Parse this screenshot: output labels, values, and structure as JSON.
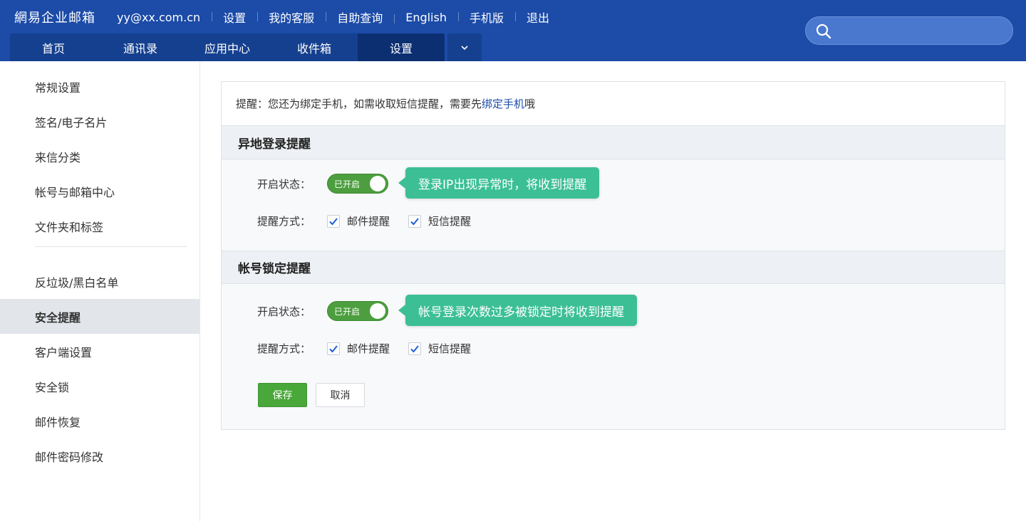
{
  "header": {
    "brand": "網易企业邮箱",
    "email": "yy@xx.com.cn",
    "links": [
      "设置",
      "我的客服",
      "自助查询",
      "English",
      "手机版",
      "退出"
    ],
    "search_placeholder": ""
  },
  "nav": {
    "tabs": [
      "首页",
      "通讯录",
      "应用中心",
      "收件箱",
      "设置"
    ],
    "active_tab": "设置",
    "more_icon": "chevron-down-icon"
  },
  "sidebar": {
    "group1": [
      "常规设置",
      "签名/电子名片",
      "来信分类",
      "帐号与邮箱中心",
      "文件夹和标签"
    ],
    "group2": [
      "反垃圾/黑白名单",
      "安全提醒",
      "客户端设置",
      "安全锁",
      "邮件恢复",
      "邮件密码修改"
    ],
    "active": "安全提醒"
  },
  "notice": {
    "prefix": "提醒：您还为绑定手机，如需收取短信提醒，需要先",
    "link": "绑定手机",
    "suffix": "哦"
  },
  "sections": [
    {
      "title": "异地登录提醒",
      "status_label": "开启状态：",
      "toggle_text": "已开启",
      "enabled": true,
      "tip": "登录IP出现异常时，将收到提醒",
      "method_label": "提醒方式：",
      "methods": [
        {
          "label": "邮件提醒",
          "checked": true
        },
        {
          "label": "短信提醒",
          "checked": true
        }
      ]
    },
    {
      "title": "帐号锁定提醒",
      "status_label": "开启状态：",
      "toggle_text": "已开启",
      "enabled": true,
      "tip": "帐号登录次数过多被锁定时将收到提醒",
      "method_label": "提醒方式：",
      "methods": [
        {
          "label": "邮件提醒",
          "checked": true
        },
        {
          "label": "短信提醒",
          "checked": true
        }
      ]
    }
  ],
  "buttons": {
    "save": "保存",
    "cancel": "取消"
  },
  "colors": {
    "header": "#1c4ba8",
    "toggle_on": "#4c9e3e",
    "tip": "#3cbf95",
    "save": "#4aa73a"
  }
}
